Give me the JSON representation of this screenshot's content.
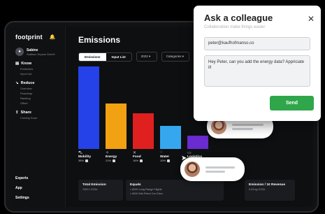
{
  "sidebar": {
    "logo": "footprint",
    "user_name": "Sabine",
    "user_company": "Sadison Krysos GmbH",
    "groups": [
      {
        "label": "Know",
        "icon": "document-icon",
        "items": [
          "Emissions",
          "Input List"
        ]
      },
      {
        "label": "Reduce",
        "icon": "reduce-icon",
        "items": [
          "Overview",
          "Roadmap",
          "Ranking",
          "Offset"
        ]
      },
      {
        "label": "Share",
        "icon": "share-icon",
        "items": [
          "Coming Soon"
        ]
      }
    ],
    "bottom": [
      "Experts",
      "App",
      "Settings"
    ]
  },
  "main": {
    "title": "Emissions",
    "tabs": [
      "Emissions",
      "Input List"
    ],
    "dropdown_year": "2022",
    "dropdown_categories": "Categories",
    "accent_colors": {
      "bar1": "#2442e8",
      "bar2": "#f2a113",
      "bar3": "#e0201f",
      "bar4": "#35a7ef",
      "bar5": "#8a2be2"
    }
  },
  "chart_data": {
    "type": "bar",
    "categories": [
      "Mobility",
      "Energy",
      "Food",
      "Water",
      "Logistics"
    ],
    "values": [
      100,
      55,
      43,
      28,
      16
    ],
    "colors": [
      "#2442e8",
      "#f2a113",
      "#e0201f",
      "#35a7ef",
      "#6a2bd0"
    ]
  },
  "categories": [
    {
      "name": "Mobility",
      "pct": "38%",
      "icon": "car-icon"
    },
    {
      "name": "Energy",
      "pct": "21%",
      "icon": "bolt-icon"
    },
    {
      "name": "Food",
      "pct": "16%",
      "icon": "food-icon"
    },
    {
      "name": "Water",
      "pct": "10%",
      "icon": "drop-icon"
    },
    {
      "name": "Logistics",
      "pct": "6%",
      "icon": "truck-icon"
    }
  ],
  "cards": [
    {
      "title": "Total Emission",
      "sub": "7000 t CO2e"
    },
    {
      "title": "Equals",
      "sub": "≈ 8000 Long Range Flights"
    },
    {
      "title": "Emission / 1€ Revenue",
      "sub": "0.03 kg CO2e"
    }
  ],
  "card_extra": "≈ 8000 Mid Petrol Car Drive",
  "modal": {
    "title": "Ask a colleague",
    "subtitle": "Collaboration make things easier",
    "email": "peter@kaufhofmanso.co",
    "message": "Hey Peter, can you add the energy data? Appriciate it!",
    "send_label": "Send"
  }
}
